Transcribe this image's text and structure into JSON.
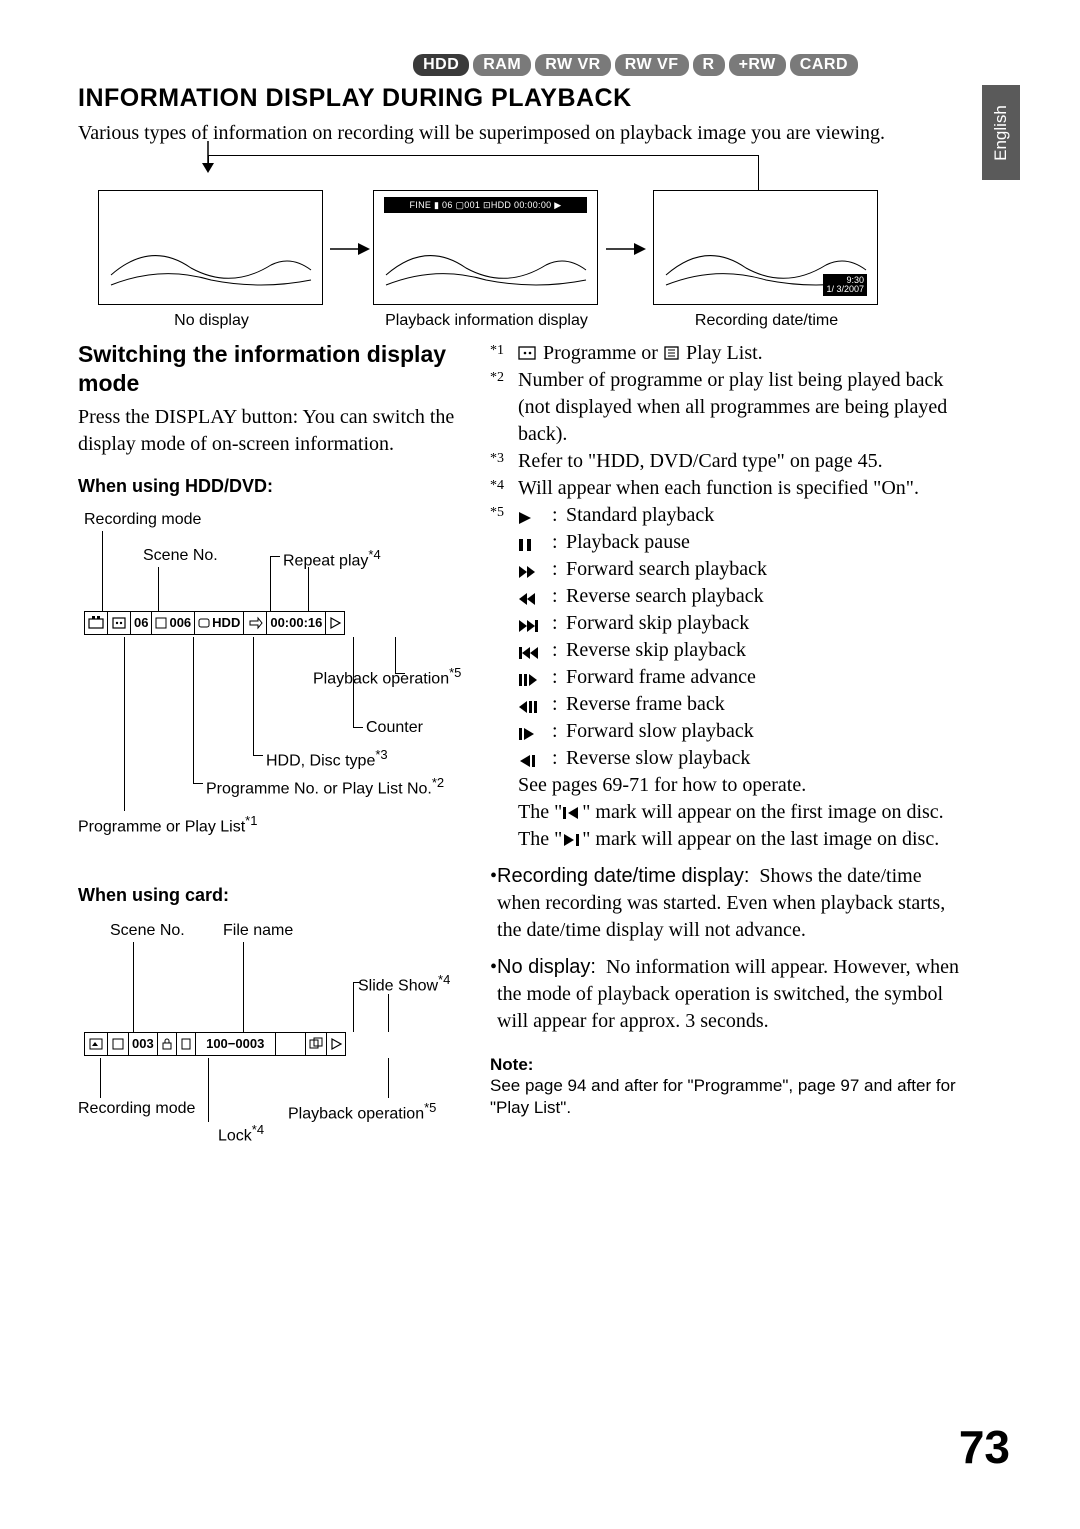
{
  "badges": [
    "HDD",
    "RAM",
    "RW VR",
    "RW VF",
    "R",
    "+RW",
    "CARD"
  ],
  "sideTab": "English",
  "title": "INFORMATION DISPLAY DURING PLAYBACK",
  "intro": "Various types of information on recording will be superimposed on playback image you are viewing.",
  "flow": {
    "noDisplay": "No display",
    "playbackInfo": "Playback information display",
    "recDate": "Recording date/time",
    "infobar": "FINE  ▮  06  ▢001  ⊡HDD  00:00:00 ▶",
    "time1": "9:30",
    "time2": "1/ 3/2007"
  },
  "left": {
    "subhead": "Switching the information display mode",
    "para": "Press the DISPLAY button: You can switch the display mode of on-screen information.",
    "hddHead": "When using HDD/DVD:",
    "cardHead": "When using card:",
    "hdd": {
      "recMode": "Recording mode",
      "sceneNo": "Scene No.",
      "repeat": "Repeat play",
      "repeatSup": "*4",
      "playbackOp": "Playback operation",
      "playbackOpSup": "*5",
      "counter": "Counter",
      "discType": "HDD, Disc type",
      "discTypeSup": "*3",
      "progNo": "Programme No. or Play List No.",
      "progNoSup": "*2",
      "progOrPL": "Programme or Play List",
      "progOrPLSup": "*1",
      "cells": {
        "c2": "06",
        "c3": "006",
        "c4": "HDD",
        "c6": "00:00:16"
      }
    },
    "card": {
      "sceneNo": "Scene No.",
      "fileName": "File name",
      "slideShow": "Slide Show",
      "slideShowSup": "*4",
      "recMode": "Recording mode",
      "playbackOp": "Playback operation",
      "playbackOpSup": "*5",
      "lock": "Lock",
      "lockSup": "*4",
      "cells": {
        "c2": "003",
        "c4": "100−0003"
      }
    }
  },
  "right": {
    "fn1a": "Programme or",
    "fn1b": "Play List.",
    "fn2": "Number of programme or play list being played back (not displayed when all programmes are being played back).",
    "fn3": "Refer to \"HDD, DVD/Card type\" on page 45.",
    "fn4": "Will appear when each function is specified \"On\".",
    "sym": {
      "play": "Standard playback",
      "pause": "Playback pause",
      "ff": "Forward search playback",
      "rw": "Reverse search playback",
      "fskip": "Forward skip playback",
      "rskip": "Reverse skip playback",
      "fframe": "Forward frame advance",
      "rframe": "Reverse frame back",
      "fslow": "Forward slow playback",
      "rslow": "Reverse slow playback"
    },
    "after1": "See pages 69-71 for how to operate.",
    "after2a": "The \"",
    "after2b": "\" mark will appear on the first image on disc.",
    "after3a": "The \"",
    "after3b": "\" mark will appear on the last image on disc.",
    "bullet1head": "Recording date/time display:",
    "bullet1body": "Shows the date/time when recording was started. Even when playback starts, the date/time display will not advance.",
    "bullet2head": "No display:",
    "bullet2body": "No information will appear. However, when the mode of playback operation is switched, the symbol will appear for approx. 3 seconds.",
    "noteHead": "Note:",
    "noteBody": "See page 94 and after for \"Programme\", page 97 and after for \"Play List\"."
  },
  "pageNum": "73"
}
